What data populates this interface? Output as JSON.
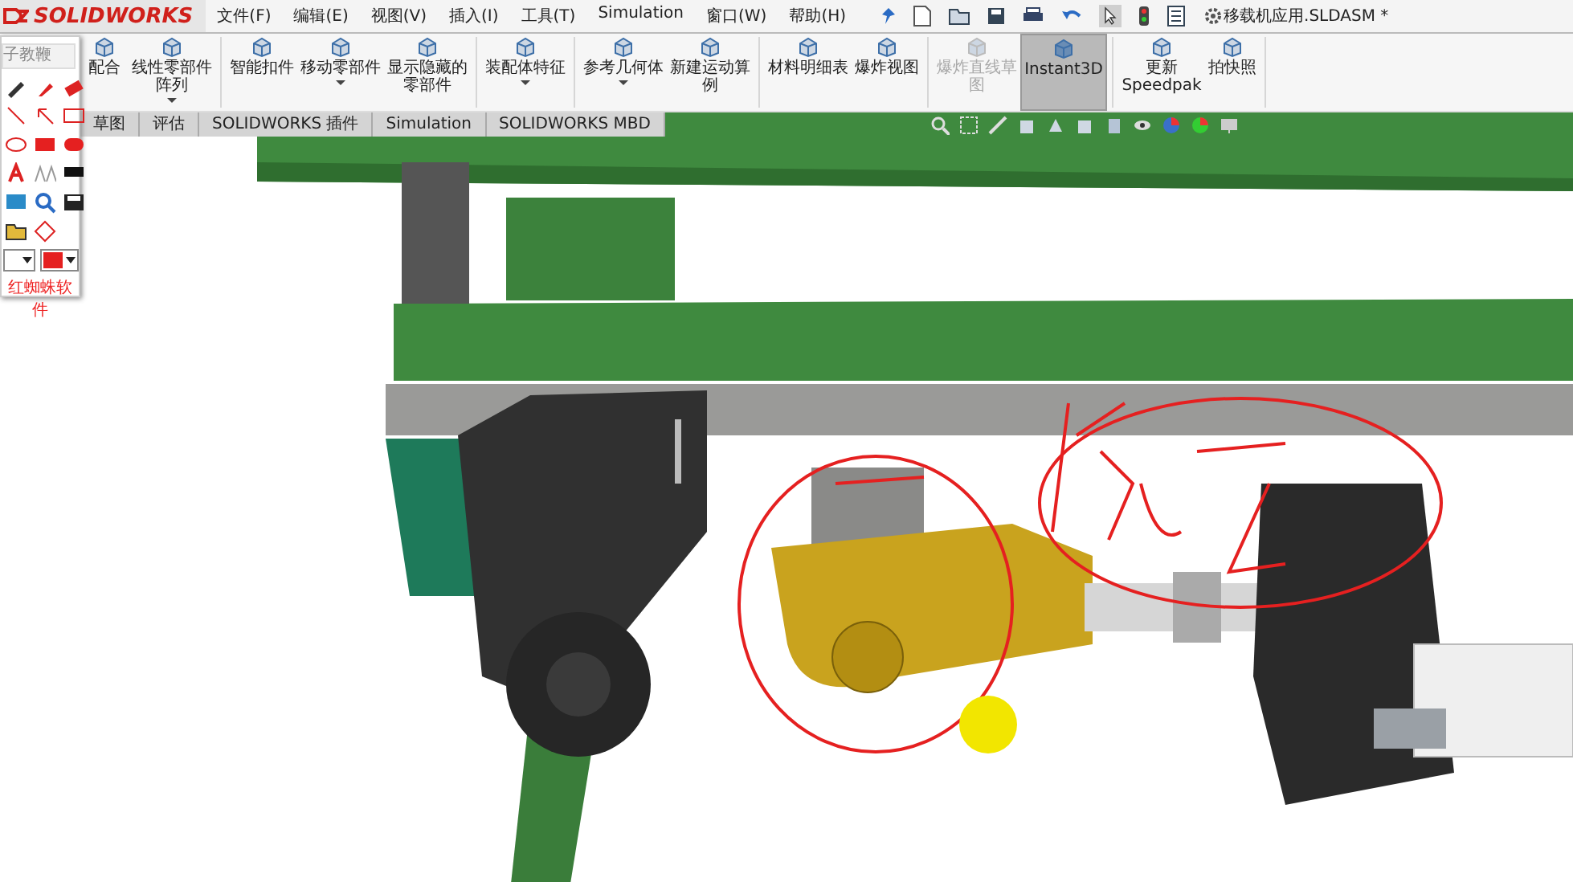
{
  "app": {
    "logo": "SOLIDWORKS",
    "menus": [
      "文件(F)",
      "编辑(E)",
      "视图(V)",
      "插入(I)",
      "工具(T)",
      "Simulation",
      "窗口(W)",
      "帮助(H)"
    ],
    "document_title": "移载机应用.SLDASM *"
  },
  "ribbon": {
    "buttons": [
      {
        "label": "配合",
        "disabled": false,
        "selected": false,
        "dropdown": false
      },
      {
        "label": "线性零部件阵列",
        "disabled": false,
        "selected": false,
        "dropdown": true
      },
      {
        "label": "智能扣件",
        "disabled": false,
        "selected": false,
        "dropdown": false
      },
      {
        "label": "移动零部件",
        "disabled": false,
        "selected": false,
        "dropdown": true
      },
      {
        "label": "显示隐藏的零部件",
        "disabled": false,
        "selected": false,
        "dropdown": false
      },
      {
        "label": "装配体特征",
        "disabled": false,
        "selected": false,
        "dropdown": true
      },
      {
        "label": "参考几何体",
        "disabled": false,
        "selected": false,
        "dropdown": true
      },
      {
        "label": "新建运动算例",
        "disabled": false,
        "selected": false,
        "dropdown": false
      },
      {
        "label": "材料明细表",
        "disabled": false,
        "selected": false,
        "dropdown": false
      },
      {
        "label": "爆炸视图",
        "disabled": false,
        "selected": false,
        "dropdown": false
      },
      {
        "label": "爆炸直线草图",
        "disabled": true,
        "selected": false,
        "dropdown": false
      },
      {
        "label": "Instant3D",
        "disabled": false,
        "selected": true,
        "dropdown": false
      },
      {
        "label": "更新 Speedpak",
        "disabled": false,
        "selected": false,
        "dropdown": false
      },
      {
        "label": "拍快照",
        "disabled": false,
        "selected": false,
        "dropdown": false
      }
    ]
  },
  "tabs": [
    {
      "label": "草图",
      "selected": false
    },
    {
      "label": "评估",
      "selected": false
    },
    {
      "label": "SOLIDWORKS 插件",
      "selected": false
    },
    {
      "label": "Simulation",
      "selected": false
    },
    {
      "label": "SOLIDWORKS MBD",
      "selected": false
    }
  ],
  "tool_panel": {
    "field": "子教鞭",
    "title": "红蜘蛛软件"
  }
}
